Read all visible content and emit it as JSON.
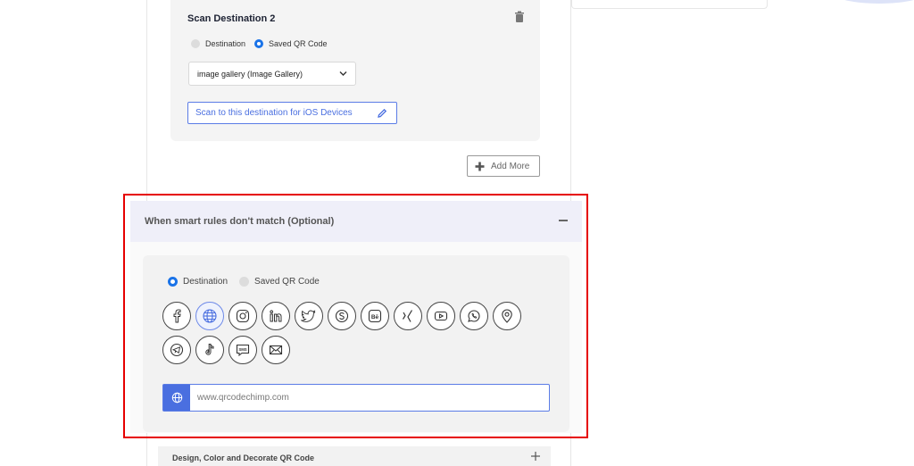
{
  "scan_destination": {
    "title": "Scan Destination 2",
    "options": [
      "Destination",
      "Saved QR Code"
    ],
    "selected_option": "Saved QR Code",
    "gallery_select": "image gallery (Image Gallery)",
    "ios_button": "Scan to this destination for iOS Devices"
  },
  "add_more_label": "Add More",
  "fallback": {
    "title": "When smart rules don't match (Optional)",
    "options": [
      "Destination",
      "Saved QR Code"
    ],
    "selected_option": "Destination",
    "icons": [
      "facebook-icon",
      "globe-icon",
      "instagram-icon",
      "linkedin-icon",
      "twitter-icon",
      "skype-icon",
      "behance-icon",
      "xing-icon",
      "youtube-icon",
      "whatsapp-icon",
      "location-pin-icon",
      "telegram-icon",
      "tiktok-icon",
      "sms-icon",
      "email-icon"
    ],
    "selected_icon": "globe-icon",
    "url_placeholder": "www.qrcodechimp.com"
  },
  "design_section": {
    "title": "Design, Color and Decorate QR Code"
  },
  "colors": {
    "accent": "#4a6fe0",
    "highlight": "#e60000",
    "radio_active": "#1a73e8"
  }
}
